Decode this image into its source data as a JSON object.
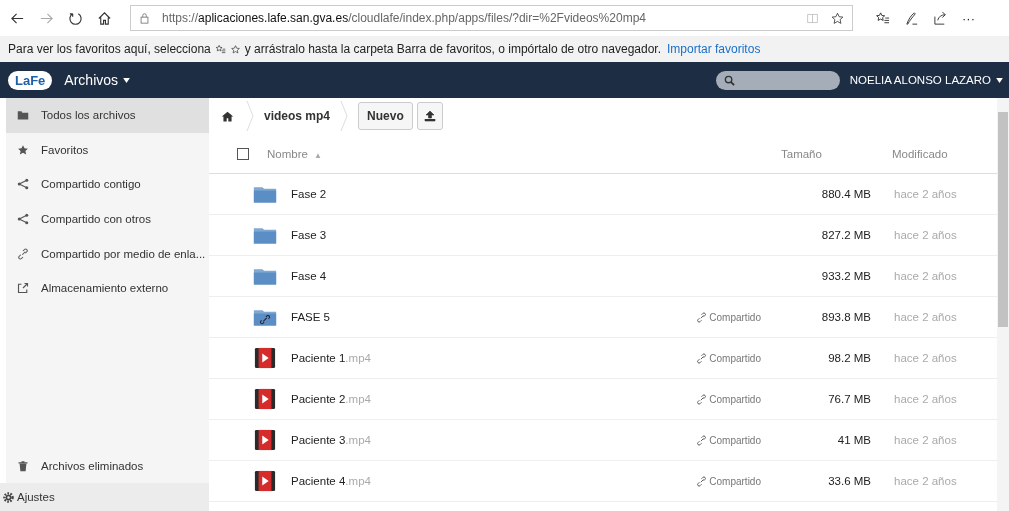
{
  "browser": {
    "url_scheme": "https://",
    "url_host": "aplicaciones.lafe.san.gva.es",
    "url_path": "/cloudlafe/index.php/apps/files/?dir=%2Fvideos%20mp4",
    "more": "···"
  },
  "favorites_bar": {
    "text_before": "Para ver los favoritos aquí, selecciona",
    "text_after": "y arrástralo hasta la carpeta Barra de favoritos, o impórtalo de otro navegador.",
    "link": "Importar favoritos"
  },
  "header": {
    "logo": "LaFe",
    "app": "Archivos",
    "user": "NOELIA ALONSO LAZARO"
  },
  "sidebar": {
    "items": [
      {
        "label": "Todos los archivos",
        "selected": true
      },
      {
        "label": "Favoritos",
        "selected": false
      },
      {
        "label": "Compartido contigo",
        "selected": false
      },
      {
        "label": "Compartido con otros",
        "selected": false
      },
      {
        "label": "Compartido por medio de enla...",
        "selected": false
      },
      {
        "label": "Almacenamiento externo",
        "selected": false
      }
    ],
    "trash": "Archivos eliminados",
    "settings": "Ajustes"
  },
  "breadcrumb": {
    "folder": "videos mp4",
    "new_button": "Nuevo"
  },
  "table": {
    "select_all_checked": false,
    "columns": {
      "name": "Nombre",
      "sort": "▲",
      "size": "Tamaño",
      "modified": "Modificado"
    },
    "rows": [
      {
        "kind": "folder",
        "name": "Fase 2",
        "size": "880.4 MB",
        "modified": "hace 2 años"
      },
      {
        "kind": "folder",
        "name": "Fase 3",
        "size": "827.2 MB",
        "modified": "hace 2 años"
      },
      {
        "kind": "folder",
        "name": "Fase 4",
        "size": "933.2 MB",
        "modified": "hace 2 años"
      },
      {
        "kind": "shared-folder",
        "name": "FASE 5",
        "share": "Compartido",
        "size": "893.8 MB",
        "modified": "hace 2 años"
      },
      {
        "kind": "video",
        "name": "Paciente 1",
        "ext": ".mp4",
        "share": "Compartido",
        "size": "98.2 MB",
        "modified": "hace 2 años"
      },
      {
        "kind": "video",
        "name": "Paciente 2",
        "ext": ".mp4",
        "share": "Compartido",
        "size": "76.7 MB",
        "modified": "hace 2 años"
      },
      {
        "kind": "video",
        "name": "Paciente 3",
        "ext": ".mp4",
        "share": "Compartido",
        "size": "41 MB",
        "modified": "hace 2 años"
      },
      {
        "kind": "video",
        "name": "Paciente 4",
        "ext": ".mp4",
        "share": "Compartido",
        "size": "33.6 MB",
        "modified": "hace 2 años"
      }
    ]
  }
}
